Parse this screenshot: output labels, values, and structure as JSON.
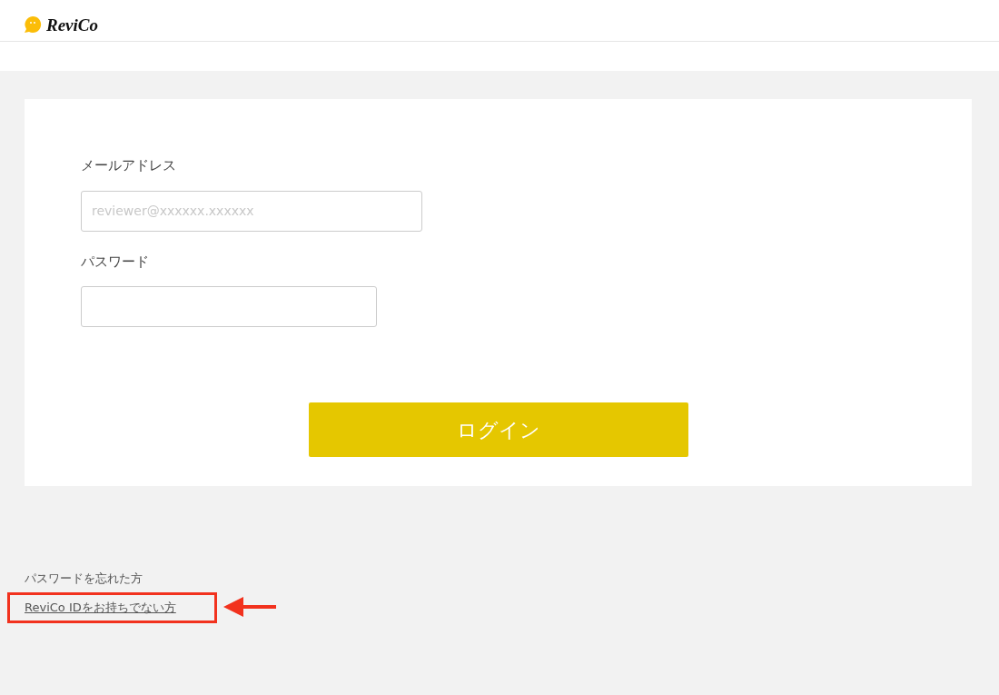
{
  "header": {
    "logo_text": "ReviCo"
  },
  "form": {
    "fields": [
      {
        "label": "メールアドレス",
        "placeholder": "reviewer@xxxxxx.xxxxxx",
        "kind": "email"
      },
      {
        "label": "パスワード",
        "kind": "password"
      }
    ],
    "submit": "ログイン"
  },
  "links": [
    {
      "text": "パスワードを忘れた方",
      "highlighted": false
    },
    {
      "text": "ReviCo IDをお持ちでない方",
      "highlighted": true
    }
  ]
}
